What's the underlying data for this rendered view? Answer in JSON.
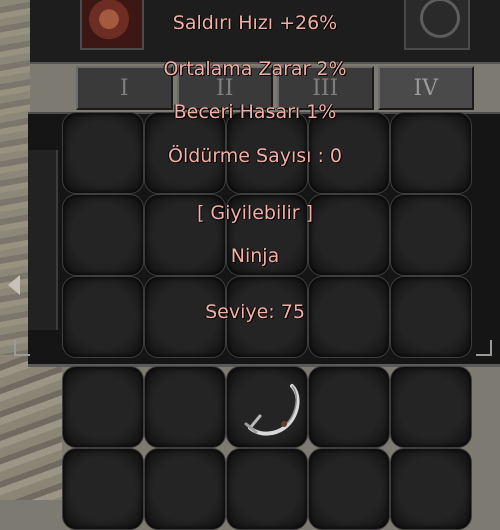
{
  "tabs": [
    {
      "label": "I",
      "active": false
    },
    {
      "label": "II",
      "active": false
    },
    {
      "label": "III",
      "active": false
    },
    {
      "label": "IV",
      "active": true
    }
  ],
  "tooltip": {
    "lines": [
      "Saldırı Hızı +26%",
      "Ortalama Zarar 2%",
      "Beceri Hasarı 1%",
      "Öldürme Sayısı : 0",
      "[ Giyilebilir ]",
      "Ninja",
      "Seviye: 75"
    ]
  },
  "colors": {
    "tooltip_text": "#f4b0a6",
    "slot_bg": "#1a1a1a",
    "frame": "#555555"
  },
  "icons": [
    "portrait-icon",
    "emblem-icon",
    "sword-item-icon",
    "scroll-left-arrow-icon"
  ]
}
